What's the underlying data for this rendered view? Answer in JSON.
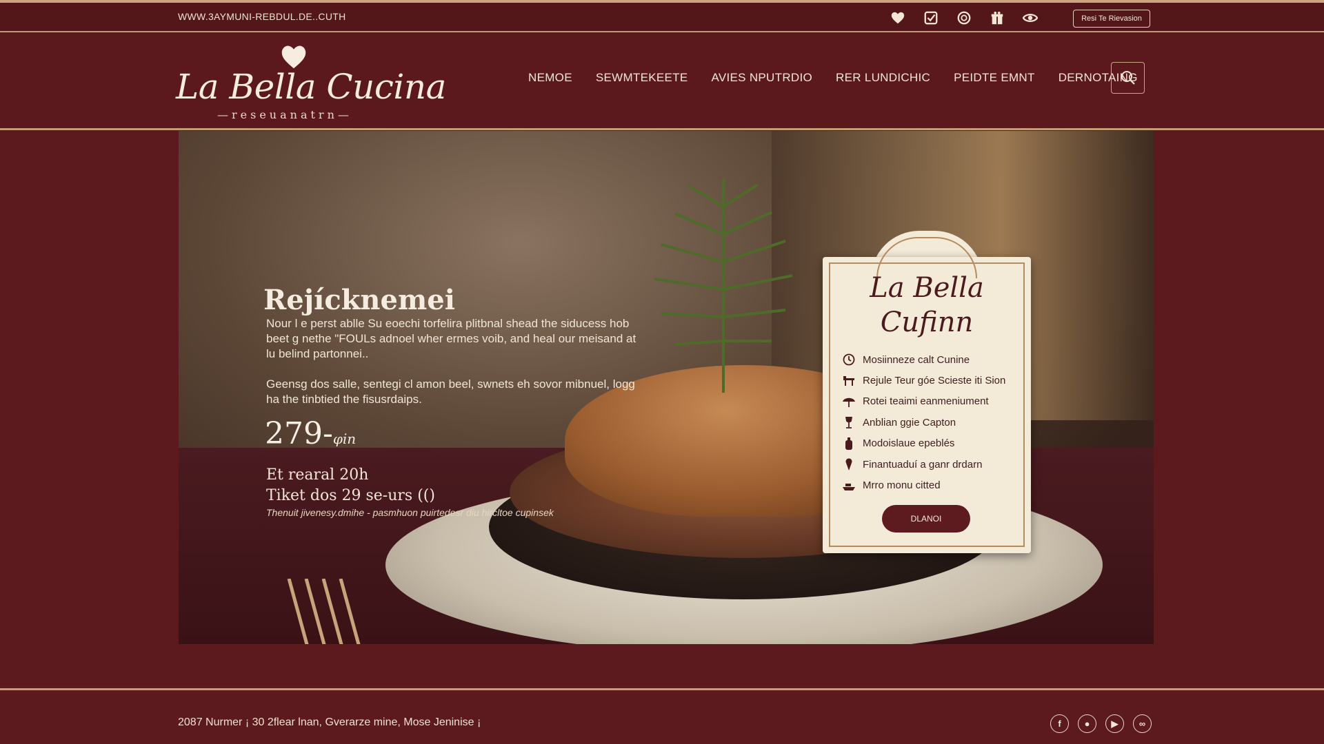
{
  "topbar": {
    "url": "WWW.3AYMUNI-REBDUL.DE..CUTH",
    "icons": [
      "heart-icon",
      "checkbox-icon",
      "badge-icon",
      "gift-icon",
      "eye-icon"
    ],
    "reserve_label": "Resi Te Rievasion"
  },
  "header": {
    "logo_text": "La Bella Cucina",
    "logo_sub": "—reseuanatrn—",
    "nav": [
      "NEMOE",
      "SEWMTEKEETE",
      "AVIES NPUTRDIO",
      "RER LUNDICHIC",
      "PEIDTE EMNT",
      "DERNOTAING"
    ]
  },
  "hero": {
    "title": "Rejícknemei",
    "paragraph1": "Nour l e perst ablle Su eoechi torfelira plitbnal shead the siducess hob beet g nethe \"FOULs adnoel wher ermes voib, and heal our meisand at lu belind partonnei..",
    "paragraph2": "Geensg dos salle, sentegi cl amon beel, swnets eh sovor mibnuel, logg ha the tinbtied the fisusrdaips.",
    "price": "279-",
    "price_unit": "φin",
    "hours_line1": "Et rearal 20h",
    "hours_line2": "Tiket dos 29 se-urs (()",
    "note": "Thenuit jivenesy.dmihe - pasmhuon puirtedesr diu hircltoe cupinsek"
  },
  "card": {
    "title_line1": "La Bella",
    "title_line2": "Cufinn",
    "items": [
      {
        "icon": "clock-icon",
        "label": "Mosiinneze calt Cunine"
      },
      {
        "icon": "table-icon",
        "label": "Rejule Teur góe Scieste iti Sion"
      },
      {
        "icon": "umbrella-icon",
        "label": "Rotei teaimi eanmeniument"
      },
      {
        "icon": "wine-glass-icon",
        "label": "Anblian ggie Capton"
      },
      {
        "icon": "bottle-icon",
        "label": "Modoislaue epeblés"
      },
      {
        "icon": "pin-icon",
        "label": "Finantuaduí a ganr drdarn"
      },
      {
        "icon": "boat-icon",
        "label": "Mrro monu citted"
      }
    ],
    "button": "DLANOI"
  },
  "footer": {
    "address": "2087 Nurmer ¡ 30 2flear lnan, Gverarze mine, Mose Jeninise ¡",
    "social": [
      {
        "icon": "facebook-icon",
        "glyph": "f"
      },
      {
        "icon": "instagram-icon",
        "glyph": "●"
      },
      {
        "icon": "youtube-icon",
        "glyph": "▶"
      },
      {
        "icon": "tripadvisor-icon",
        "glyph": "∞"
      }
    ]
  },
  "colors": {
    "background": "#5c1a1f",
    "accent_line": "#c69d79",
    "card_bg": "#f4ead8",
    "button_bg": "#5d1b1f"
  }
}
